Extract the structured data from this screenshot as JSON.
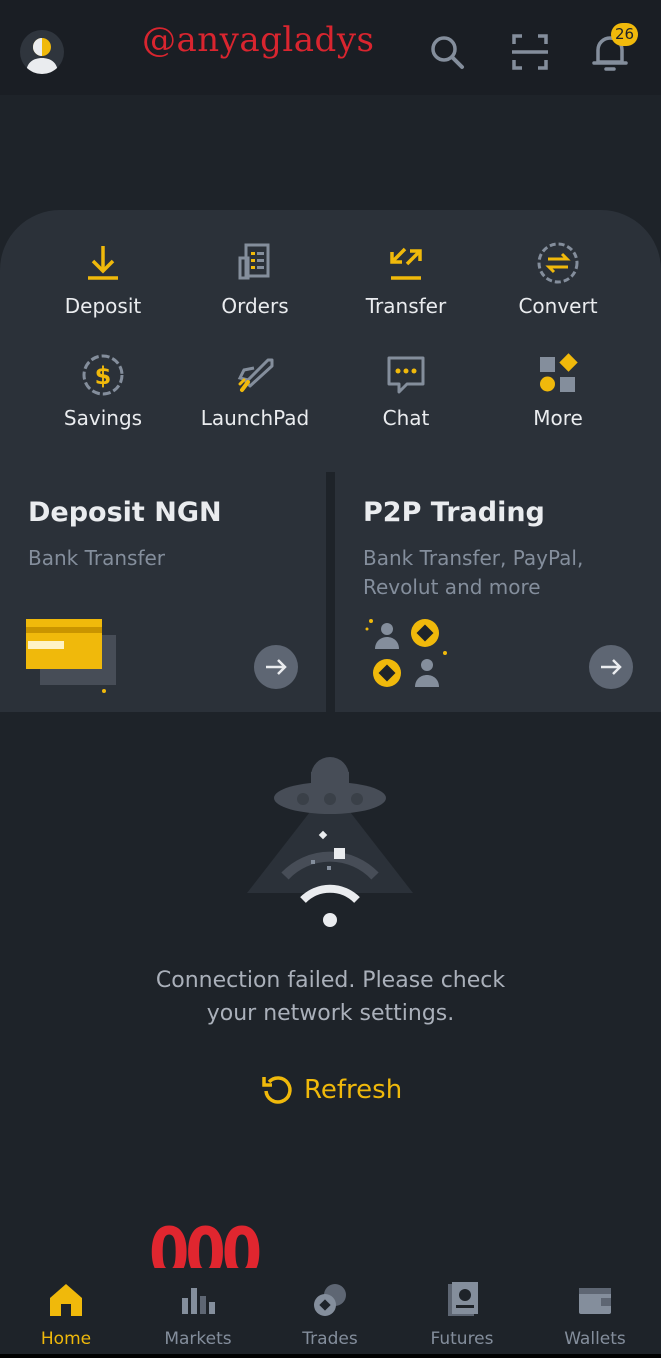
{
  "header": {
    "watermark": "@anyagladys",
    "notification_count": "26"
  },
  "actions": [
    {
      "label": "Deposit",
      "icon": "download-icon"
    },
    {
      "label": "Orders",
      "icon": "orders-icon"
    },
    {
      "label": "Transfer",
      "icon": "transfer-icon"
    },
    {
      "label": "Convert",
      "icon": "convert-icon"
    },
    {
      "label": "Savings",
      "icon": "savings-icon"
    },
    {
      "label": "LaunchPad",
      "icon": "rocket-icon"
    },
    {
      "label": "Chat",
      "icon": "chat-icon"
    },
    {
      "label": "More",
      "icon": "more-icon"
    }
  ],
  "cards": {
    "deposit": {
      "title": "Deposit NGN",
      "subtitle": "Bank Transfer"
    },
    "p2p": {
      "title": "P2P Trading",
      "subtitle": "Bank Transfer, PayPal, Revolut and more"
    }
  },
  "error": {
    "message": "Connection failed. Please check your network settings.",
    "refresh_label": "Refresh"
  },
  "overlay_text": "000",
  "nav": [
    {
      "label": "Home",
      "active": true
    },
    {
      "label": "Markets",
      "active": false
    },
    {
      "label": "Trades",
      "active": false
    },
    {
      "label": "Futures",
      "active": false
    },
    {
      "label": "Wallets",
      "active": false
    }
  ],
  "colors": {
    "accent": "#f0b90b",
    "background": "#1e2329",
    "panel": "#2b3139",
    "muted": "#848e9c"
  }
}
